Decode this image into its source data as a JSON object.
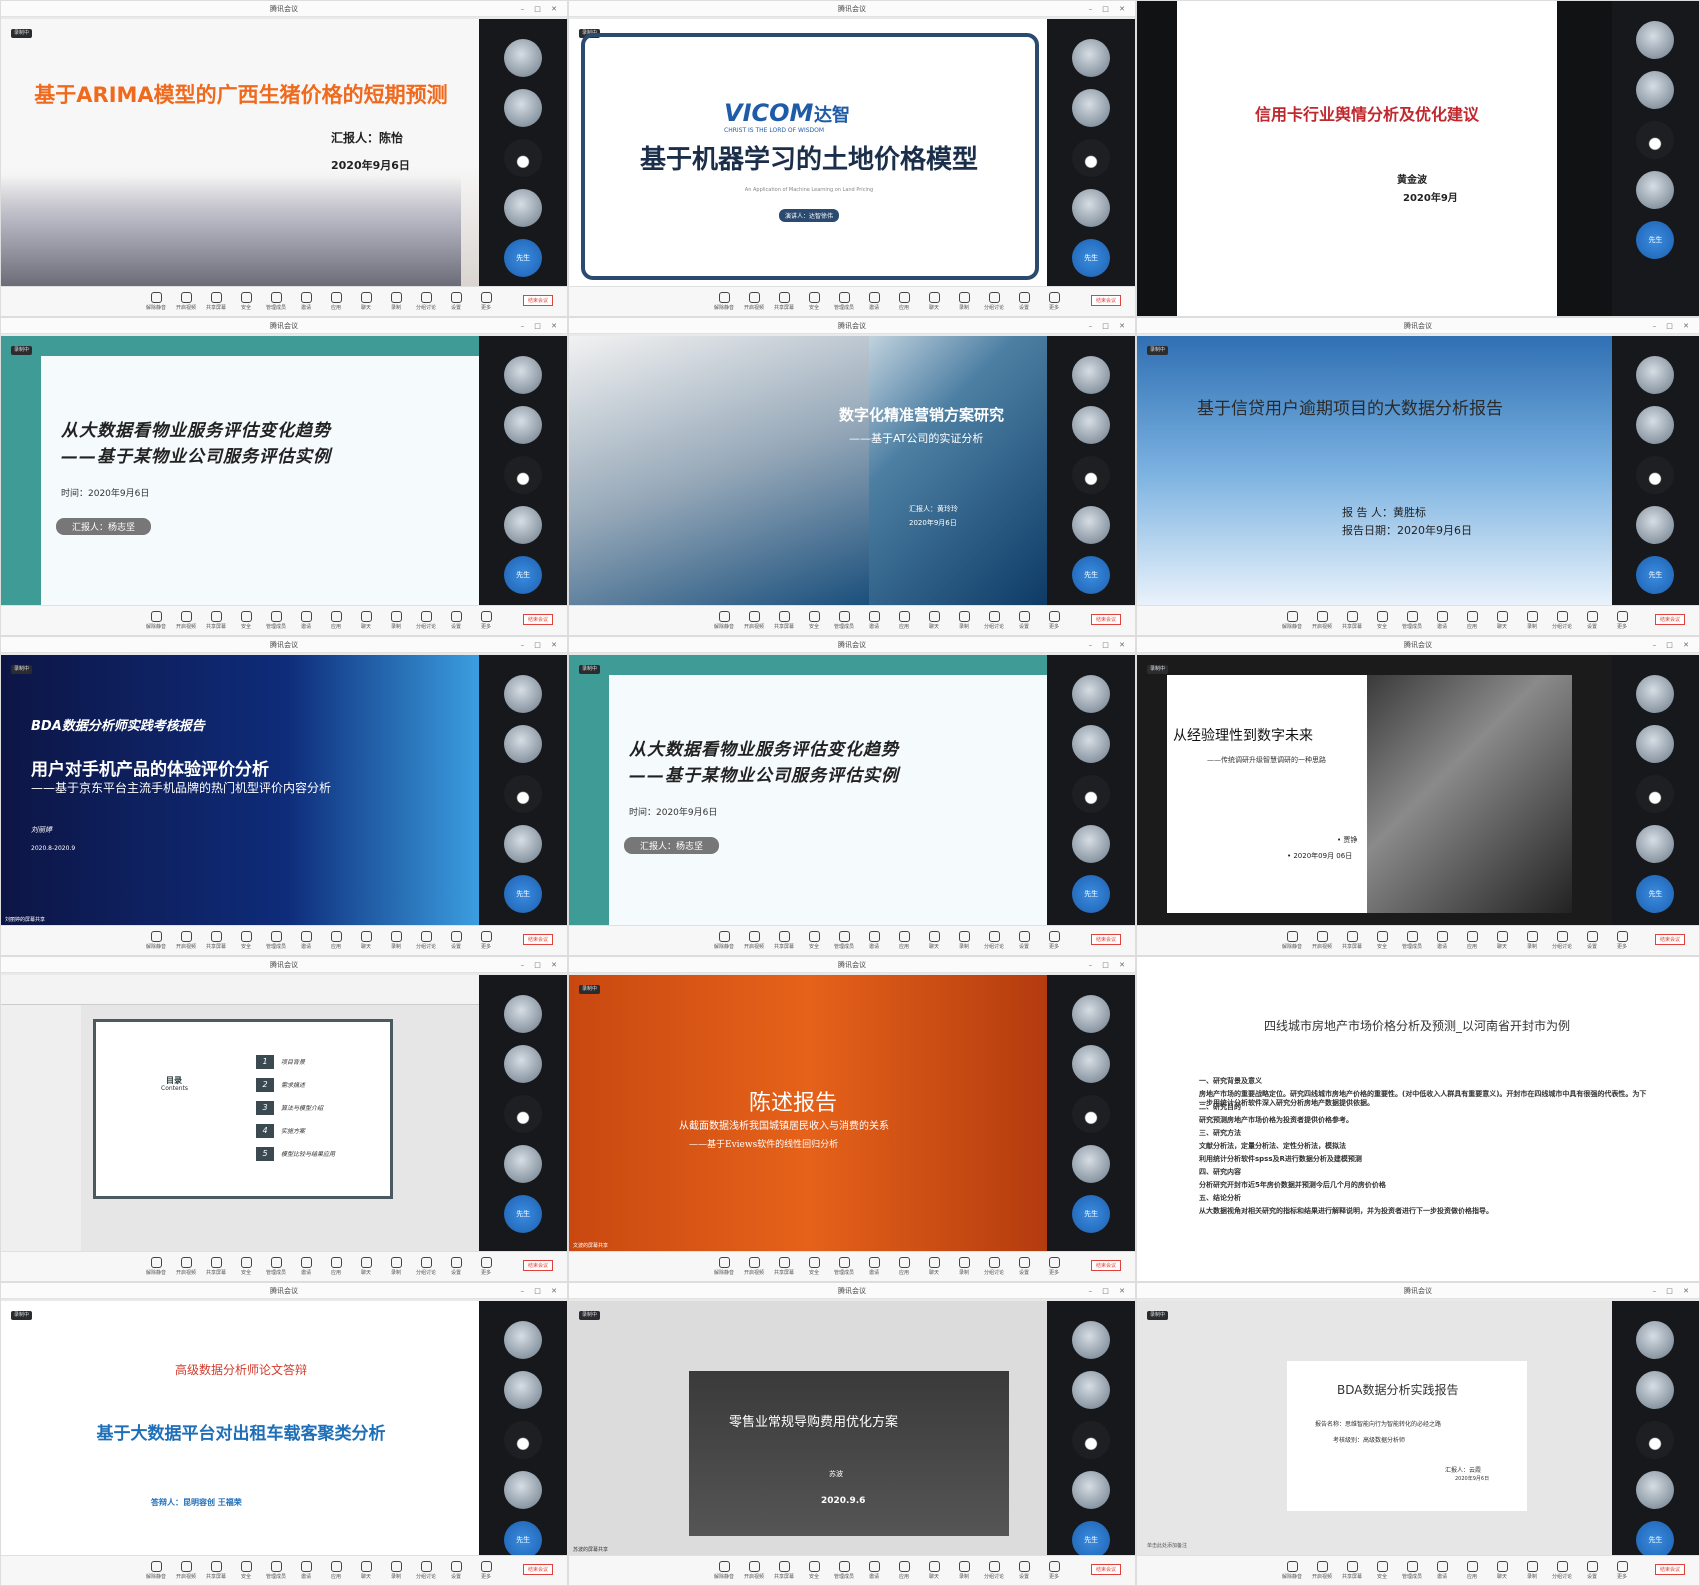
{
  "window_title": "腾讯会议",
  "recording": "录制中",
  "end_button": "结束会议",
  "share_label": "的屏幕共享",
  "self_label": "先生",
  "toolbar": [
    "解除静音",
    "开启视频",
    "共享屏幕",
    "安全",
    "管理成员",
    "邀请",
    "应用",
    "聊天",
    "录制",
    "分组讨论",
    "设置",
    "更多"
  ],
  "clocks": [
    "07:04:50",
    "06:57:01",
    "07:21:57",
    "02:30:43",
    "07:21:57",
    "06:56:11",
    "07:58:09",
    "03:06:49"
  ],
  "tiles": [
    {
      "title": "基于ARIMA模型的广西生猪价格的短期预测",
      "presenter": "汇报人：陈怡",
      "date": "2020年9月6日",
      "share": "陈怡的屏幕共享"
    },
    {
      "logo": "VICOM",
      "logo2": "达智",
      "logo_sub": "CHRIST IS THE LORD OF WISDOM",
      "title": "基于机器学习的土地价格模型",
      "subtitle": "An Application of Machine Learning on Land Pricing",
      "presenter": "演讲人：达智徐伟"
    },
    {
      "title": "信用卡行业舆情分析及优化建议",
      "presenter": "黄金波",
      "date": "2020年9月"
    },
    {
      "title1": "从大数据看物业服务评估变化趋势",
      "title2": "——基于某物业公司服务评估实例",
      "time": "时间：2020年9月6日",
      "presenter": "汇报人：杨志坚"
    },
    {
      "title": "数字化精准营销方案研究",
      "subtitle": "——基于AT公司的实证分析",
      "presenter": "汇报人：黄玲玲",
      "date": "2020年9月6日",
      "share": "黄玲玲的屏幕共享"
    },
    {
      "title": "基于信贷用户逾期项目的大数据分析报告",
      "presenter": "报 告 人：黄胜标",
      "date": "报告日期：2020年9月6日"
    },
    {
      "series": "BDA数据分析师实践考核报告",
      "title": "用户对手机产品的体验评价分析",
      "subtitle": "——基于京东平台主流手机品牌的热门机型评价内容分析",
      "presenter": "刘丽婷",
      "date": "2020.8-2020.9",
      "share": "刘丽婷的屏幕共享"
    },
    {
      "title1": "从大数据看物业服务评估变化趋势",
      "title2": "——基于某物业公司服务评估实例",
      "time": "时间：2020年9月6日",
      "presenter": "汇报人：杨志坚"
    },
    {
      "title": "从经验理性到数字未来",
      "subtitle": "——传统调研升级智慧调研的一种思路",
      "presenter": "• 贾铮",
      "date": "• 2020年09月 06日",
      "share": "贾铮的屏幕共享"
    },
    {
      "heading": "目录",
      "heading_en": "Contents",
      "items": [
        {
          "n": "1",
          "t": "项目背景"
        },
        {
          "n": "2",
          "t": "需求描述"
        },
        {
          "n": "3",
          "t": "算法与模型介绍"
        },
        {
          "n": "4",
          "t": "实施方案"
        },
        {
          "n": "5",
          "t": "模型比较与结果应用"
        }
      ]
    },
    {
      "title": "陈述报告",
      "subtitle1": "从截面数据浅析我国城镇居民收入与消费的关系",
      "subtitle2": "——基于Eviews软件的线性回归分析",
      "share": "文波的屏幕共享"
    },
    {
      "title": "四线城市房地产市场价格分析及预测_以河南省开封市为例",
      "lines": [
        "一、研究背景及意义",
        "房地产市场的重要战略定位。研究四线城市房地产价格的重要性。(对中低收入人群具有重要意义)。开封市在四线城市中具有很强的代表性。为下一步用统计分析软件深入研究分析房地产数据提供依据。",
        "二、研究目的",
        "研究预测房地产市场价格为投资者提供价格参考。",
        "三、研究方法",
        "文献分析法，定量分析法、定性分析法，模拟法",
        "利用统计分析软件spss及R进行数据分析及建模预测",
        "四、研究内容",
        "分析研究开封市近5年房价数据并预测今后几个月的房价价格",
        "五、结论分析",
        "从大数据视角对相关研究的指标和结果进行解释说明，并为投资者进行下一步投资做价格指导。"
      ]
    },
    {
      "heading": "高级数据分析师论文答辩",
      "title": "基于大数据平台对出租车载客聚类分析",
      "presenter": "答辩人：昆明容创 王福荣"
    },
    {
      "title": "零售业常规导购费用优化方案",
      "presenter": "苏波",
      "date": "2020.9.6",
      "share": "苏波的屏幕共享"
    },
    {
      "title": "BDA数据分析实践报告",
      "topic": "报告名称：思维智能向行为智能转化的必经之路",
      "level": "考核级别：高级数据分析师",
      "presenter": "汇报人：云霞",
      "date": "2020年9月6日",
      "note": "单击此处添加备注"
    }
  ]
}
